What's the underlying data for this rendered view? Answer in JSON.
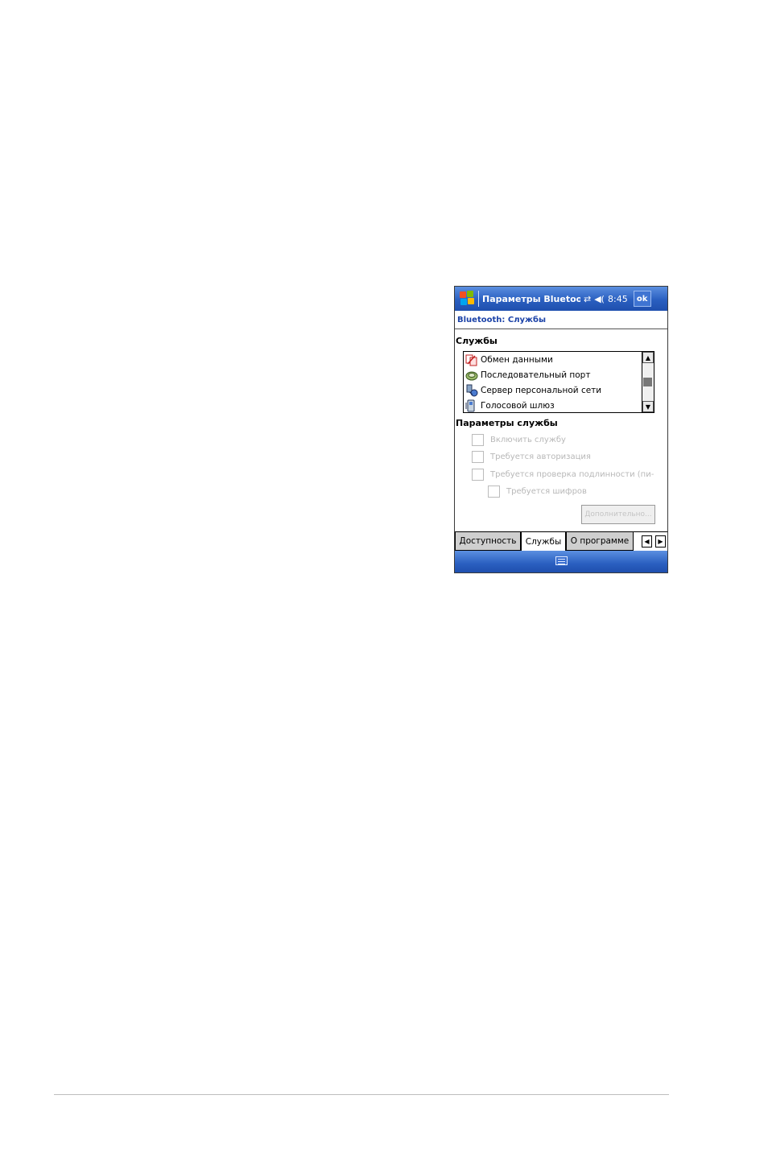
{
  "titlebar": {
    "app_title": "Параметры Bluetoo",
    "time": "8:45",
    "ok_label": "ok"
  },
  "header": {
    "title": "Bluetooth: Службы"
  },
  "services": {
    "label": "Службы",
    "items": [
      {
        "label": "Обмен данными",
        "icon": "data-exchange-icon"
      },
      {
        "label": "Последовательный порт",
        "icon": "serial-port-icon"
      },
      {
        "label": "Сервер персональной сети",
        "icon": "pan-server-icon"
      },
      {
        "label": "Голосовой шлюз",
        "icon": "voice-gateway-icon"
      }
    ]
  },
  "service_params": {
    "label": "Параметры службы",
    "options": [
      {
        "label": "Включить службу",
        "checked": false
      },
      {
        "label": "Требуется авторизация",
        "checked": false
      },
      {
        "label": "Требуется проверка подлинности (пи-",
        "checked": false
      },
      {
        "label": "Требуется шифров",
        "checked": false
      }
    ],
    "advanced_label": "Дополнительно..."
  },
  "tabs": [
    {
      "label": "Доступность",
      "active": false
    },
    {
      "label": "Службы",
      "active": true
    },
    {
      "label": "О программе",
      "active": false
    }
  ],
  "colors": {
    "titlebar": "#2a5fc0",
    "header_text": "#1c43a8",
    "disabled_text": "#b8b8b8"
  }
}
